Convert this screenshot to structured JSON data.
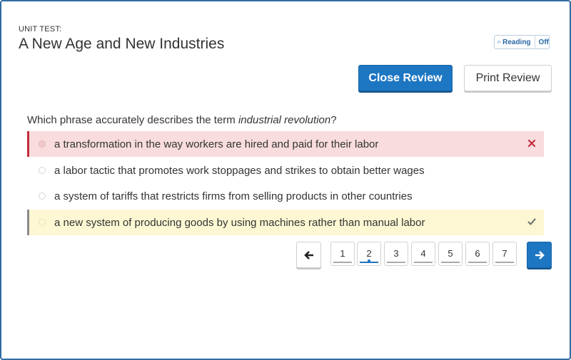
{
  "header": {
    "unit_label": "UNIT TEST:",
    "title": "A New Age and New Industries",
    "reading": {
      "label": "Reading",
      "state": "Off"
    }
  },
  "actions": {
    "close_review": "Close Review",
    "print_review": "Print Review"
  },
  "question": {
    "prefix": "Which phrase accurately describes the term ",
    "term": "industrial revolution",
    "suffix": "?",
    "options": [
      {
        "text": "a transformation in the way workers are hired and paid for their labor",
        "status": "incorrect"
      },
      {
        "text": "a labor tactic that promotes work stoppages and strikes to obtain better wages",
        "status": "none"
      },
      {
        "text": "a system of tariffs that restricts firms from selling products in other countries",
        "status": "none"
      },
      {
        "text": "a new system of producing goods by using machines rather than manual labor",
        "status": "correct"
      }
    ]
  },
  "pagination": {
    "pages": [
      "1",
      "2",
      "3",
      "4",
      "5",
      "6",
      "7"
    ],
    "current": "2"
  },
  "colors": {
    "primary": "#1d76c2",
    "incorrect_bg": "#f9dcdd",
    "incorrect_accent": "#c42b3a",
    "correct_bg": "#fdf8d3",
    "check_mark": "#777777"
  }
}
